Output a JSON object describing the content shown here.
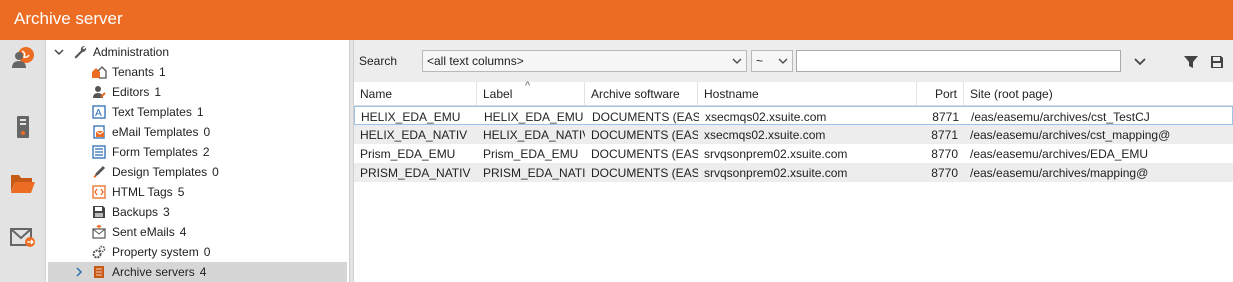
{
  "window": {
    "title": "Archive server"
  },
  "rail": {
    "items": [
      {
        "icon": "users-globe-icon"
      },
      {
        "icon": "server-icon"
      },
      {
        "icon": "folder-open-icon"
      },
      {
        "icon": "mail-forward-icon"
      }
    ]
  },
  "tree": {
    "root": {
      "label": "Administration",
      "icon": "wrench-icon"
    },
    "items": [
      {
        "label": "Tenants",
        "count": "1",
        "icon": "houses-icon"
      },
      {
        "label": "Editors",
        "count": "1",
        "icon": "editor-user-icon"
      },
      {
        "label": "Text Templates",
        "count": "1",
        "icon": "text-template-icon"
      },
      {
        "label": "eMail Templates",
        "count": "0",
        "icon": "email-template-icon"
      },
      {
        "label": "Form Templates",
        "count": "2",
        "icon": "form-template-icon"
      },
      {
        "label": "Design Templates",
        "count": "0",
        "icon": "design-template-icon"
      },
      {
        "label": "HTML Tags",
        "count": "5",
        "icon": "html-tags-icon"
      },
      {
        "label": "Backups",
        "count": "3",
        "icon": "floppy-disk-icon"
      },
      {
        "label": "Sent eMails",
        "count": "4",
        "icon": "sent-mail-icon"
      },
      {
        "label": "Property system",
        "count": "0",
        "icon": "gears-icon"
      },
      {
        "label": "Archive servers",
        "count": "4",
        "icon": "archive-server-icon"
      }
    ]
  },
  "search": {
    "label": "Search",
    "column_value": "<all text columns>",
    "operator_value": "~",
    "text_value": ""
  },
  "toolbar": {
    "icons": [
      "chevron-down-icon",
      "filter-icon",
      "save-icon"
    ]
  },
  "grid": {
    "columns": [
      "Name",
      "Label",
      "Archive software",
      "Hostname",
      "Port",
      "Site (root page)"
    ],
    "rows": [
      [
        "HELIX_EDA_EMU",
        "HELIX_EDA_EMU",
        "DOCUMENTS (EAS)",
        "xsecmqs02.xsuite.com",
        "8771",
        "/eas/easemu/archives/cst_TestCJ"
      ],
      [
        "HELIX_EDA_NATIV",
        "HELIX_EDA_NATIV",
        "DOCUMENTS (EAS)",
        "xsecmqs02.xsuite.com",
        "8771",
        "/eas/easemu/archives/cst_mapping@"
      ],
      [
        "Prism_EDA_EMU",
        "Prism_EDA_EMU",
        "DOCUMENTS (EAS)",
        "srvqsonprem02.xsuite.com",
        "8770",
        "/eas/easemu/archives/EDA_EMU"
      ],
      [
        "PRISM_EDA_NATIV",
        "PRISM_EDA_NATIV",
        "DOCUMENTS (EAS)",
        "srvqsonprem02.xsuite.com",
        "8770",
        "/eas/easemu/archives/mapping@"
      ]
    ]
  },
  "colors": {
    "titlebar": "#ec6c23",
    "accent_blue": "#2e6db4",
    "selection": "#d6d6d6"
  }
}
